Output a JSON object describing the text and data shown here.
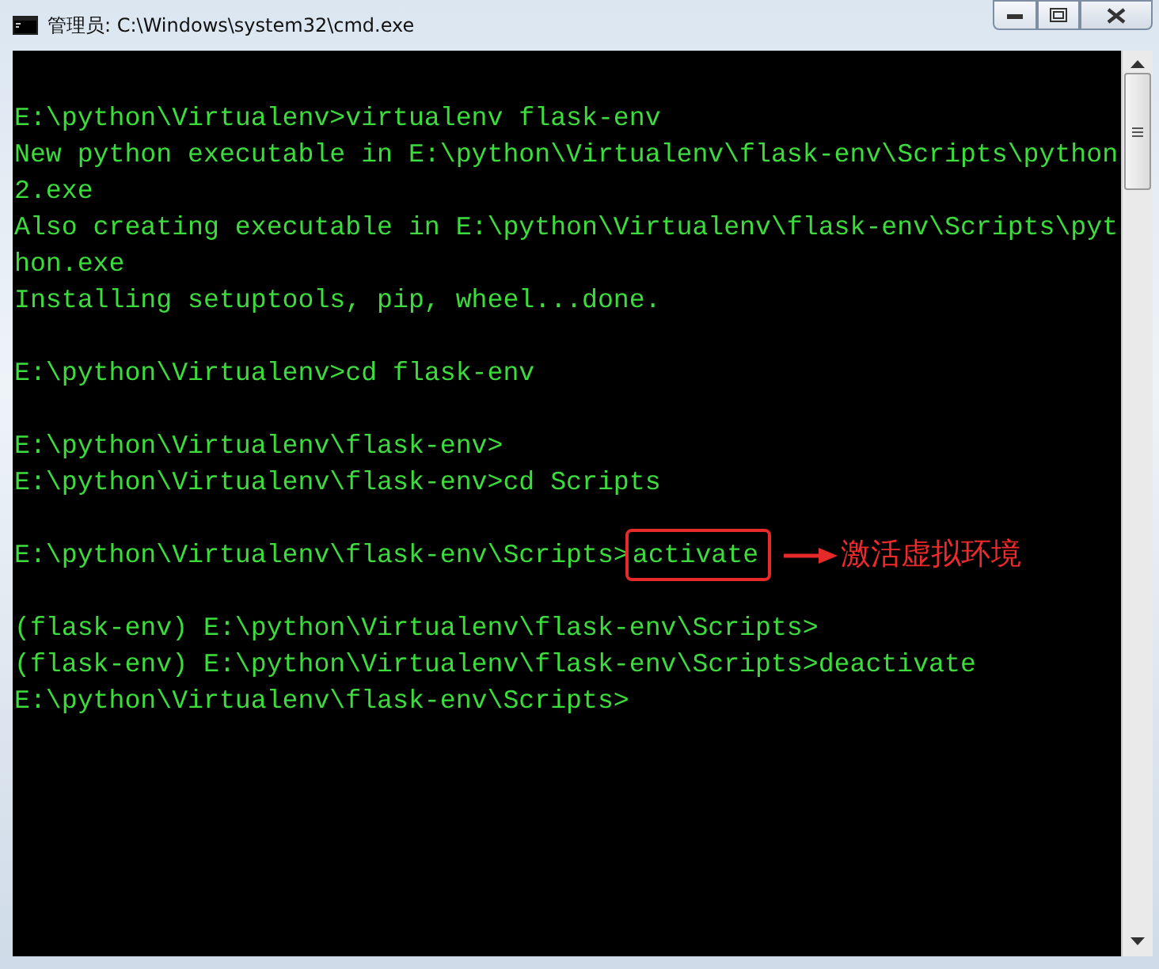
{
  "window": {
    "title": "管理员: C:\\Windows\\system32\\cmd.exe"
  },
  "console": {
    "lines": [
      {
        "kind": "blank"
      },
      {
        "kind": "text",
        "text": "E:\\python\\Virtualenv>virtualenv flask-env"
      },
      {
        "kind": "text",
        "text": "New python executable in E:\\python\\Virtualenv\\flask-env\\Scripts\\python"
      },
      {
        "kind": "text",
        "text": "2.exe"
      },
      {
        "kind": "text",
        "text": "Also creating executable in E:\\python\\Virtualenv\\flask-env\\Scripts\\pyt"
      },
      {
        "kind": "text",
        "text": "hon.exe"
      },
      {
        "kind": "text",
        "text": "Installing setuptools, pip, wheel...done."
      },
      {
        "kind": "blank"
      },
      {
        "kind": "text",
        "text": "E:\\python\\Virtualenv>cd flask-env"
      },
      {
        "kind": "blank"
      },
      {
        "kind": "text",
        "text": "E:\\python\\Virtualenv\\flask-env>"
      },
      {
        "kind": "text",
        "text": "E:\\python\\Virtualenv\\flask-env>cd Scripts"
      },
      {
        "kind": "blank"
      },
      {
        "kind": "annotated",
        "prompt": "E:\\python\\Virtualenv\\flask-env\\Scripts>",
        "command": "activate",
        "note": "激活虚拟环境"
      },
      {
        "kind": "blank"
      },
      {
        "kind": "text",
        "text": "(flask-env) E:\\python\\Virtualenv\\flask-env\\Scripts>"
      },
      {
        "kind": "text",
        "text": "(flask-env) E:\\python\\Virtualenv\\flask-env\\Scripts>deactivate"
      },
      {
        "kind": "text",
        "text": "E:\\python\\Virtualenv\\flask-env\\Scripts>"
      }
    ]
  }
}
